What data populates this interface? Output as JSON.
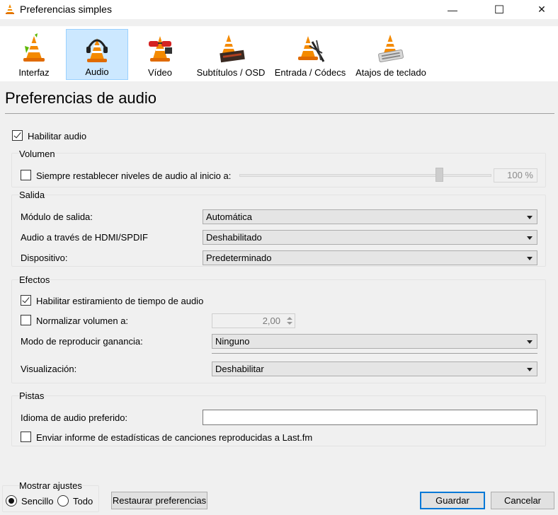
{
  "window": {
    "title": "Preferencias simples",
    "minimize_glyph": "—",
    "maximize_glyph": "☐",
    "close_glyph": "✕"
  },
  "categories": [
    {
      "label": "Interfaz",
      "icon": "vlc-cone-icon"
    },
    {
      "label": "Audio",
      "icon": "headphones-cone-icon",
      "selected": true
    },
    {
      "label": "Vídeo",
      "icon": "glasses-cone-icon"
    },
    {
      "label": "Subtítulos / OSD",
      "icon": "subtitles-cone-icon"
    },
    {
      "label": "Entrada / Códecs",
      "icon": "cables-cone-icon"
    },
    {
      "label": "Atajos de teclado",
      "icon": "keyboard-cone-icon"
    }
  ],
  "page": {
    "heading": "Preferencias de audio",
    "enable_audio_label": "Habilitar audio",
    "enable_audio_checked": true
  },
  "volume": {
    "group_title": "Volumen",
    "reset_label": "Siempre restablecer niveles de audio al inicio a:",
    "reset_checked": false,
    "value_text": "100 %",
    "slider_level": 0.79
  },
  "output": {
    "group_title": "Salida",
    "module_label": "Módulo de salida:",
    "module_value": "Automática",
    "hdmi_label": "Audio a través de HDMI/SPDIF",
    "hdmi_value": "Deshabilitado",
    "device_label": "Dispositivo:",
    "device_value": "Predeterminado"
  },
  "effects": {
    "group_title": "Efectos",
    "stretch_label": "Habilitar estiramiento de tiempo de audio",
    "stretch_checked": true,
    "normalize_label": "Normalizar volumen a:",
    "normalize_checked": false,
    "normalize_value": "2,00",
    "replaygain_label": "Modo de reproducir ganancia:",
    "replaygain_value": "Ninguno",
    "visualization_label": "Visualización:",
    "visualization_value": "Deshabilitar"
  },
  "tracks": {
    "group_title": "Pistas",
    "language_label": "Idioma de audio preferido:",
    "language_value": "",
    "lastfm_label": "Enviar informe de estadísticas de canciones reproducidas a Last.fm",
    "lastfm_checked": false
  },
  "footer": {
    "show_settings_title": "Mostrar ajustes",
    "simple_label": "Sencillo",
    "all_label": "Todo",
    "selected_mode": "Sencillo",
    "reset_button": "Restaurar preferencias",
    "save_button": "Guardar",
    "cancel_button": "Cancelar"
  }
}
